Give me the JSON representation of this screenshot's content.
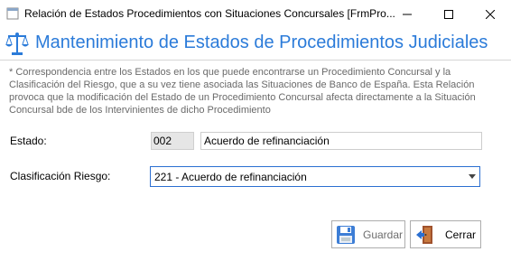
{
  "window": {
    "title": "Relación de Estados Procedimientos con Situaciones Concursales [FrmPro..."
  },
  "header": {
    "title": "Mantenimiento de Estados de Procedimientos Judiciales",
    "icon": "scales-icon",
    "color": "#2b7bd9"
  },
  "note": "* Correspondencia entre los Estados en los que puede encontrarse un Procedimiento Concursal y la Clasificación del Riesgo, que a su vez tiene asociada las Situaciones de Banco de España. Esta Relación provoca que la modificación del Estado de un Procedimiento Concursal afecta directamente a la Situación Concursal bde de los Intervinientes de dicho Procedimiento",
  "form": {
    "estado_label": "Estado:",
    "estado_code": "002",
    "estado_desc": "Acuerdo de refinanciación",
    "clasificacion_label": "Clasificación Riesgo:",
    "clasificacion_value": "221 - Acuerdo de refinanciación"
  },
  "buttons": {
    "save": "Guardar",
    "close": "Cerrar"
  }
}
